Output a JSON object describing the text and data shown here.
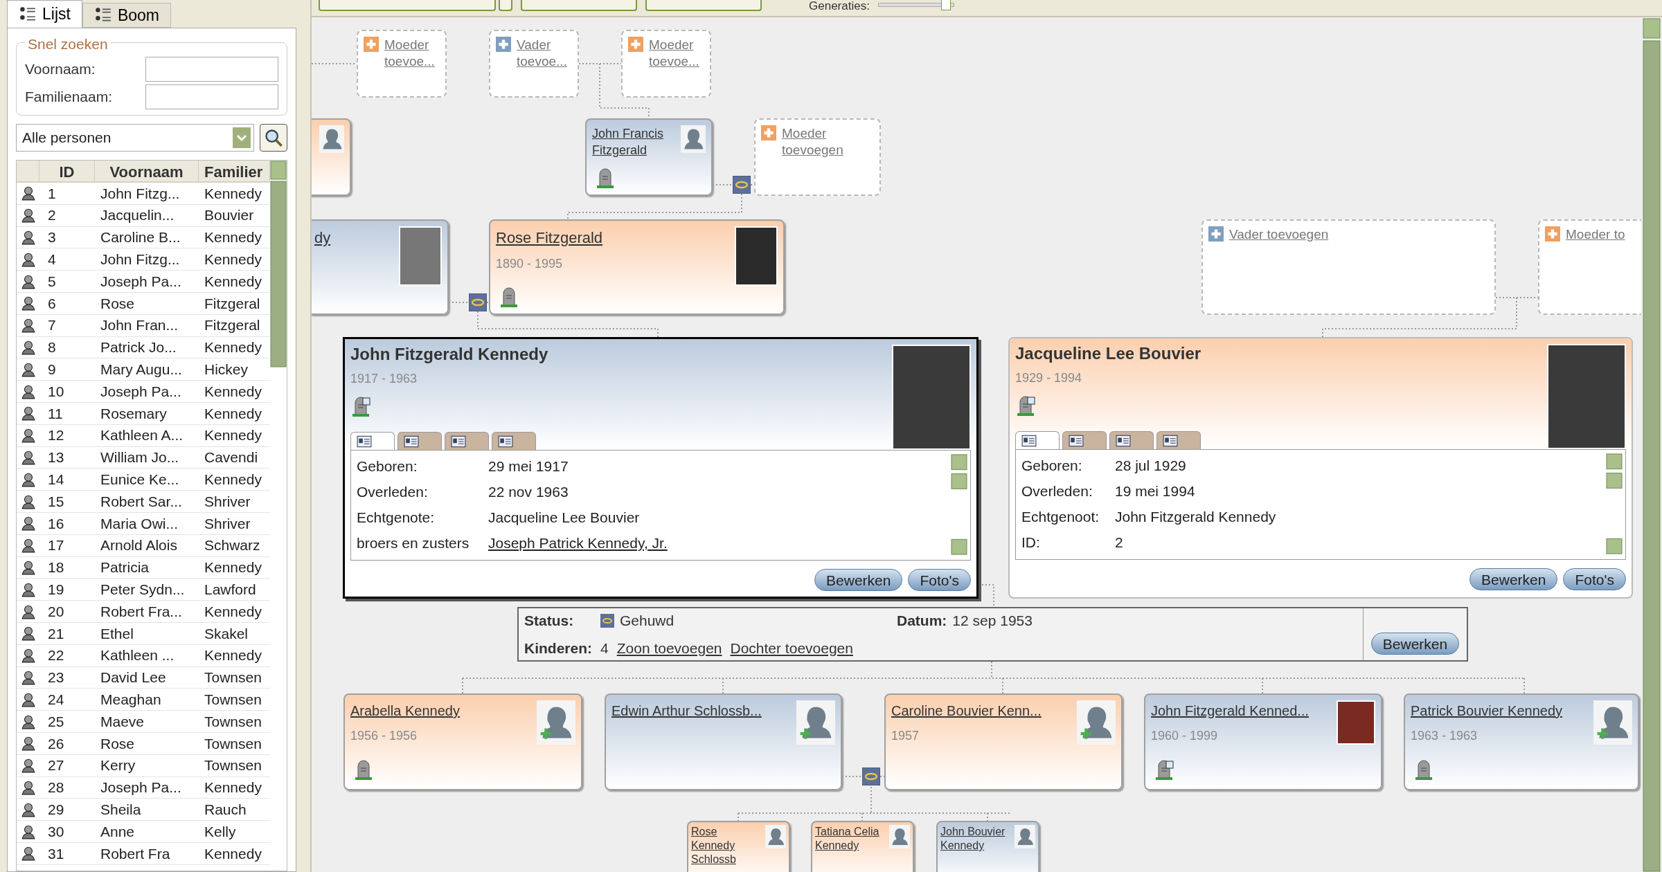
{
  "tabs": [
    {
      "label": "Lijst",
      "selected": true
    },
    {
      "label": "Boom",
      "selected": false
    }
  ],
  "quick_search": {
    "title": "Snel zoeken",
    "fields": [
      {
        "label": "Voornaam:"
      },
      {
        "label": "Familienaam:"
      }
    ]
  },
  "filter": {
    "value": "Alle personen"
  },
  "table": {
    "columns": [
      "ID",
      "Voornaam",
      "Familier"
    ],
    "rows": [
      {
        "id": "1",
        "first": "John Fitzg...",
        "last": "Kennedy"
      },
      {
        "id": "2",
        "first": "Jacquelin...",
        "last": "Bouvier"
      },
      {
        "id": "3",
        "first": "Caroline B...",
        "last": "Kennedy"
      },
      {
        "id": "4",
        "first": "John Fitzg...",
        "last": "Kennedy"
      },
      {
        "id": "5",
        "first": "Joseph Pa...",
        "last": "Kennedy"
      },
      {
        "id": "6",
        "first": "Rose",
        "last": "Fitzgeral"
      },
      {
        "id": "7",
        "first": "John Fran...",
        "last": "Fitzgeral"
      },
      {
        "id": "8",
        "first": "Patrick Jo...",
        "last": "Kennedy"
      },
      {
        "id": "9",
        "first": "Mary Augu...",
        "last": "Hickey"
      },
      {
        "id": "10",
        "first": "Joseph Pa...",
        "last": "Kennedy"
      },
      {
        "id": "11",
        "first": "Rosemary",
        "last": "Kennedy"
      },
      {
        "id": "12",
        "first": "Kathleen A...",
        "last": "Kennedy"
      },
      {
        "id": "13",
        "first": "William Jo...",
        "last": "Cavendi"
      },
      {
        "id": "14",
        "first": "Eunice Ke...",
        "last": "Kennedy"
      },
      {
        "id": "15",
        "first": "Robert Sar...",
        "last": "Shriver"
      },
      {
        "id": "16",
        "first": "Maria Owi...",
        "last": "Shriver"
      },
      {
        "id": "17",
        "first": "Arnold Alois",
        "last": "Schwarz"
      },
      {
        "id": "18",
        "first": "Patricia",
        "last": "Kennedy"
      },
      {
        "id": "19",
        "first": "Peter Sydn...",
        "last": "Lawford"
      },
      {
        "id": "20",
        "first": "Robert Fra...",
        "last": "Kennedy"
      },
      {
        "id": "21",
        "first": "Ethel",
        "last": "Skakel"
      },
      {
        "id": "22",
        "first": "Kathleen ...",
        "last": "Kennedy"
      },
      {
        "id": "23",
        "first": "David Lee",
        "last": "Townsen"
      },
      {
        "id": "24",
        "first": "Meaghan",
        "last": "Townsen"
      },
      {
        "id": "25",
        "first": "Maeve",
        "last": "Townsen"
      },
      {
        "id": "26",
        "first": "Rose",
        "last": "Townsen"
      },
      {
        "id": "27",
        "first": "Kerry",
        "last": "Townsen"
      },
      {
        "id": "28",
        "first": "Joseph Pa...",
        "last": "Kennedy"
      },
      {
        "id": "29",
        "first": "Sheila",
        "last": "Rauch"
      },
      {
        "id": "30",
        "first": "Anne",
        "last": "Kelly"
      },
      {
        "id": "31",
        "first": "Robert Fra",
        "last": "Kennedy"
      }
    ]
  },
  "toolbar": {
    "generations_label": "Generaties:",
    "generations_slider": {
      "level": 0.9
    }
  },
  "ancestors": [
    {
      "kind": "add",
      "color": "#f0a060",
      "label": "Moeder toevoe..."
    },
    {
      "kind": "add",
      "color": "#7f9ec0",
      "label": "Vader toevoe..."
    },
    {
      "kind": "add",
      "color": "#f0a060",
      "label": "Moeder toevoe..."
    },
    {
      "kind": "person",
      "color": "#fbcfae",
      "photo": false,
      "deceased": false
    },
    {
      "kind": "person",
      "color": "#bccbdd",
      "name": "John Francis Fitzgerald",
      "photo": false,
      "deceased": true
    },
    {
      "kind": "add",
      "color": "#f0a060",
      "label": "Moeder toevoegen"
    },
    {
      "kind": "person",
      "color": "#bccbdd",
      "name": "dy",
      "photo": true,
      "deceased": false
    },
    {
      "kind": "person",
      "color": "#fbcfae",
      "name": "Rose Fitzgerald",
      "years": "1890 - 1995",
      "photo": true,
      "deceased": true
    },
    {
      "kind": "add",
      "color": "#7f9ec0",
      "label": "Vader toevoegen"
    },
    {
      "kind": "add",
      "color": "#f0a060",
      "label": "Moeder to"
    }
  ],
  "couple": [
    {
      "color": "#bccbdd",
      "selected": true,
      "name": "John Fitzgerald Kennedy",
      "years": "1917 - 1963",
      "tabs": [
        {
          "selected": true
        },
        {
          "selected": false
        },
        {
          "selected": false
        },
        {
          "selected": false
        }
      ],
      "details": [
        {
          "label": "Geboren:",
          "value": "29 mei 1917",
          "link": false
        },
        {
          "label": "Overleden:",
          "value": "22 nov 1963",
          "link": false
        },
        {
          "label": "Echtgenote:",
          "value": "Jacqueline Lee Bouvier",
          "link": false
        },
        {
          "label": "broers en zusters",
          "value": "Joseph Patrick Kennedy, Jr.",
          "link": true
        }
      ],
      "buttons": [
        "Bewerken",
        "Foto's"
      ]
    },
    {
      "color": "#fbcfae",
      "selected": false,
      "name": "Jacqueline Lee Bouvier",
      "years": "1929 - 1994",
      "tabs": [
        {
          "selected": true
        },
        {
          "selected": false
        },
        {
          "selected": false
        },
        {
          "selected": false
        }
      ],
      "details": [
        {
          "label": "Geboren:",
          "value": "28 jul 1929",
          "link": false
        },
        {
          "label": "Overleden:",
          "value": "19 mei 1994",
          "link": false
        },
        {
          "label": "Echtgenoot:",
          "value": "John Fitzgerald Kennedy",
          "link": false
        },
        {
          "label": "ID:",
          "value": "2",
          "link": false
        }
      ],
      "buttons": [
        "Bewerken",
        "Foto's"
      ]
    }
  ],
  "marriage": {
    "status_label": "Status:",
    "status": "Gehuwd",
    "date_label": "Datum:",
    "date": "12 sep 1953",
    "children_label": "Kinderen:",
    "children_count": "4",
    "links": [
      "Zoon toevoegen",
      "Dochter toevoegen"
    ],
    "button": "Bewerken"
  },
  "children": [
    {
      "color": "#fbcfae",
      "name": "Arabella Kennedy",
      "years": "1956 - 1956",
      "photo": false,
      "deceased": true
    },
    {
      "color": "#bccbdd",
      "name": "Edwin Arthur Schlossb...",
      "photo": false,
      "deceased": false
    },
    {
      "color": "#fbcfae",
      "name": "Caroline Bouvier Kenn...",
      "years": "1957",
      "photo": false,
      "deceased": false
    },
    {
      "color": "#bccbdd",
      "name": "John Fitzgerald Kenned...",
      "years": "1960 - 1999",
      "photo": true,
      "deceased": true
    },
    {
      "color": "#bccbdd",
      "name": "Patrick Bouvier Kennedy",
      "years": "1963 - 1963",
      "photo": false,
      "deceased": true
    }
  ],
  "grandchildren": [
    {
      "color": "#fbcfae",
      "name": "Rose Kennedy Schlossb"
    },
    {
      "color": "#fbcfae",
      "name": "Tatiana Celia Kennedy"
    },
    {
      "color": "#bccbdd",
      "name": "John Bouvier Kennedy"
    }
  ]
}
